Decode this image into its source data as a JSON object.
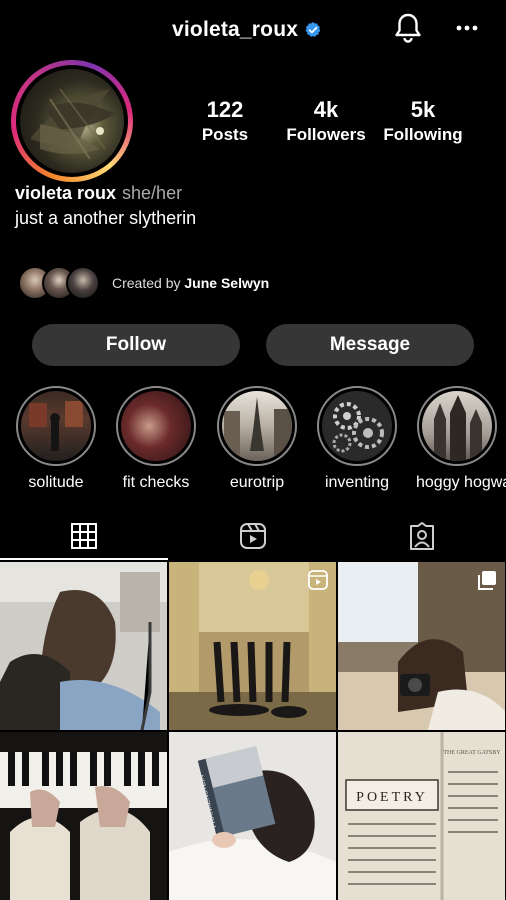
{
  "header": {
    "username": "violeta_roux",
    "verified_icon": "verified-badge-icon",
    "bell_icon": "bell-icon",
    "more_icon": "more-dots-icon"
  },
  "profile": {
    "stats": [
      {
        "num": "122",
        "label": "Posts"
      },
      {
        "num": "4k",
        "label": "Followers"
      },
      {
        "num": "5k",
        "label": "Following"
      }
    ],
    "display_name": "violeta roux",
    "pronouns": "she/her",
    "bio": "just a another slytherin",
    "creator_prefix": "Created by",
    "creator_name": "June Selwyn"
  },
  "actions": {
    "follow_label": "Follow",
    "message_label": "Message"
  },
  "highlights": [
    {
      "label": "solitude"
    },
    {
      "label": "fit checks"
    },
    {
      "label": "eurotrip"
    },
    {
      "label": "inventing"
    },
    {
      "label": "hoggy hogwa"
    }
  ],
  "tabs": [
    {
      "name": "posts-grid",
      "icon": "grid-icon"
    },
    {
      "name": "reels",
      "icon": "reels-icon"
    },
    {
      "name": "tagged",
      "icon": "tagged-person-icon"
    }
  ],
  "posts": {
    "post_7_book_title": "FRANKENSTEIN",
    "post_9_heading": "POETRY",
    "post_9_top": "THE GREAT GATSBY"
  },
  "colors": {
    "background": "#000000",
    "button_bg": "#363636",
    "verified_blue": "#3897f0",
    "ring_gradient_start": "#f58529",
    "ring_gradient_mid": "#dd2a7b"
  }
}
